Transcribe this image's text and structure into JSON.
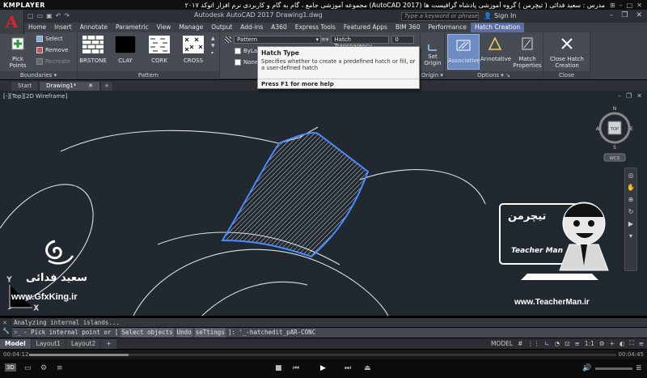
{
  "player": {
    "logo": "KMPLAYER",
    "title": "مجموعه آموزشی جامع ، گام به گام و کاربردی نرم افزار  اتوکد ۲۰۱۷ (AutoCAD 2017)  مدرس : سعید فدائی ( تیچرمن ) گروه آموزشی پادشاه گرافیست ها",
    "time_elapsed": "00:04:12",
    "time_total": "00:04:45",
    "progress_fraction": 0.17,
    "sub_badge": "3D"
  },
  "app": {
    "title": "Autodesk AutoCAD 2017    Drawing1.dwg",
    "logo_letter": "A",
    "search_placeholder": "Type a keyword or phrase",
    "sign_in": "Sign In"
  },
  "ribbon_tabs": [
    "Home",
    "Insert",
    "Annotate",
    "Parametric",
    "View",
    "Manage",
    "Output",
    "Add-ins",
    "A360",
    "Express Tools",
    "Featured Apps",
    "BIM 360",
    "Performance",
    "Hatch Creation"
  ],
  "ribbon": {
    "boundaries": {
      "label": "Boundaries",
      "pick_points": "Pick Points",
      "select": "Select",
      "remove": "Remove",
      "recreate": "Recreate"
    },
    "pattern": {
      "label": "Pattern",
      "swatches": [
        "BRSTONE",
        "CLAY",
        "CORK",
        "CROSS"
      ]
    },
    "properties": {
      "type_value": "Pattern",
      "bylayer": "ByLayer",
      "none": "None",
      "transparency_label": "Hatch Transparency",
      "transparency_value": "0"
    },
    "origin": {
      "label": "Origin",
      "set_origin": "Set Origin"
    },
    "options": {
      "label": "Options",
      "associative": "Associative",
      "annotative": "Annotative",
      "match_properties": "Match Properties"
    },
    "close": {
      "label": "Close",
      "close_btn": "Close Hatch Creation"
    }
  },
  "tooltip": {
    "title": "Hatch Type",
    "description": "Specifies whether to create a predefined hatch or fill, or a user-defined hatch",
    "help": "Press F1 for more help"
  },
  "file_tabs": [
    "Start",
    "Drawing1*"
  ],
  "viewport": {
    "label": "[-][Top][2D Wireframe]",
    "viewcube_top": "TOP",
    "viewcube_n": "N",
    "viewcube_s": "S",
    "viewcube_e": "E",
    "viewcube_w": "W",
    "wcs": "WCS"
  },
  "watermarks": {
    "author_fa": "سعید فدائی",
    "site_left": "www.GfxKing.ir",
    "brand_fa": "تیچرمن",
    "brand_en": "Teacher Man",
    "site_right": "www.TeacherMan.ir"
  },
  "command": {
    "history": "Analyzing internal islands...",
    "prompt_pre": "- Pick internal point or [",
    "opt1": "Select objects",
    "opt2": "Undo",
    "opt3": "seTtings",
    "prompt_post": "]: '_-hatchedit_pAR-CONC"
  },
  "layout_tabs": [
    "Model",
    "Layout1",
    "Layout2"
  ],
  "status": {
    "model": "MODEL",
    "scale": "1:1"
  }
}
